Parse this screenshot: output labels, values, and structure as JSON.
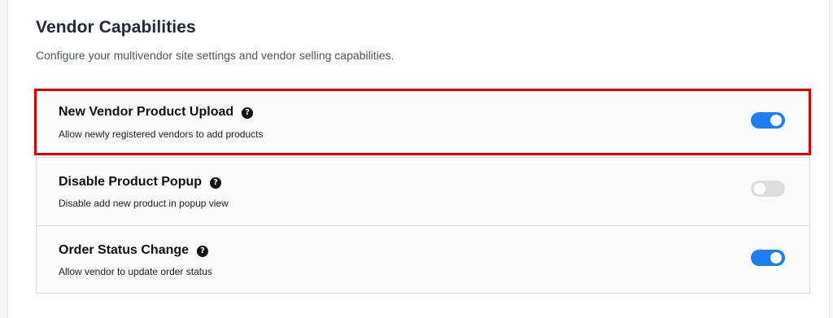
{
  "header": {
    "title": "Vendor Capabilities",
    "subtitle": "Configure your multivendor site settings and vendor selling capabilities."
  },
  "settings": [
    {
      "title": "New Vendor Product Upload",
      "description": "Allow newly registered vendors to add products",
      "help_icon": "question-circle-icon",
      "enabled": true,
      "highlighted": true
    },
    {
      "title": "Disable Product Popup",
      "description": "Disable add new product in popup view",
      "help_icon": "question-circle-icon",
      "enabled": false,
      "highlighted": false
    },
    {
      "title": "Order Status Change",
      "description": "Allow vendor to update order status",
      "help_icon": "question-circle-icon",
      "enabled": true,
      "highlighted": false
    }
  ],
  "colors": {
    "toggle_on": "#1d7ef4",
    "toggle_off": "#dddddd",
    "highlight_border": "#e00000"
  }
}
